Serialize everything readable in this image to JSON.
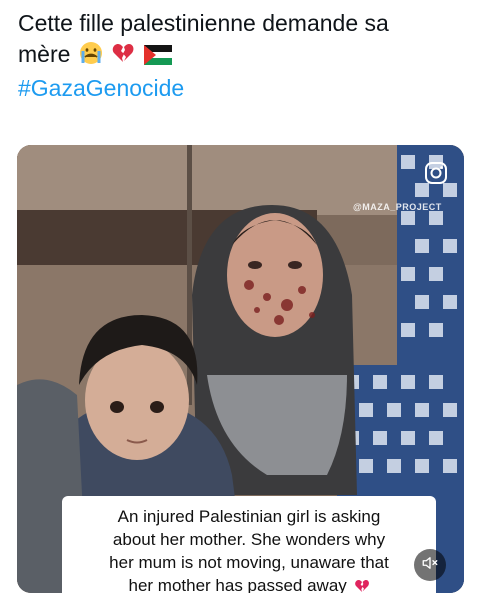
{
  "tweet": {
    "line1": "Cette fille palestinienne demande sa",
    "line2": "mère",
    "hashtag": "#GazaGenocide"
  },
  "media": {
    "watermark": "@MAZA_PROJECT",
    "caption": {
      "line1": "An injured Palestinian girl is asking",
      "line2": "about her mother. She wonders why",
      "line3": "her mum is not moving, unaware that",
      "line4": "her mother has passed away"
    }
  },
  "icons": {
    "crying_face": "crying-face-icon",
    "broken_heart": "broken-heart-icon",
    "palestine_flag": "palestine-flag-icon",
    "instagram": "instagram-icon",
    "mute": "speaker-muted-icon"
  },
  "colors": {
    "text": "#0f1419",
    "hashtag": "#1d9bf0",
    "broken_heart": "#e0245e"
  }
}
